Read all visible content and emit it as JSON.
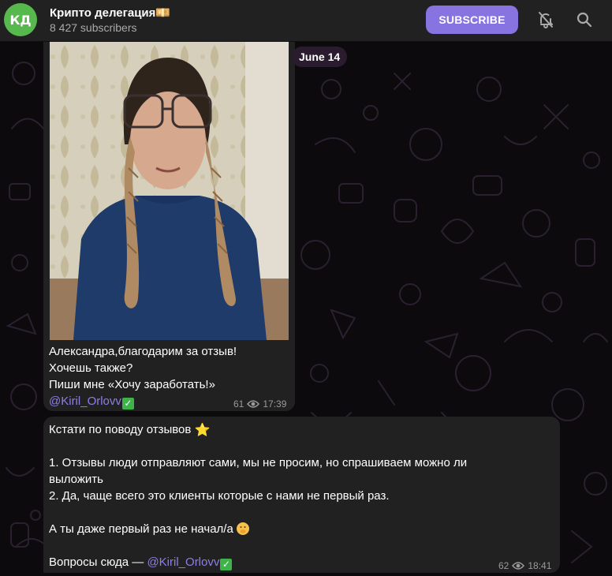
{
  "header": {
    "avatar_initials": "КД",
    "title": "Крипто делегация💴",
    "subscribers": "8 427 subscribers",
    "subscribe_label": "SUBSCRIBE",
    "icons": [
      "bell-off-icon",
      "search-icon"
    ]
  },
  "chat": {
    "date_pill": "June 14",
    "messages": [
      {
        "lines": [
          "Александра,благодарим за отзыв!",
          "Хочешь также?",
          "Пиши мне «Хочу заработать!»"
        ],
        "link": "@Kiril_Orlovv",
        "link_suffix": "✅",
        "views": "61",
        "time": "17:39"
      },
      {
        "line1": "Кстати по поводу отзывов",
        "line1_emoji": "⭐",
        "line2": "1. Отзывы люди отправляют сами, мы не просим, но спрашиваем можно ли",
        "line3": "выложить",
        "line4": "2. Да, чаще всего это клиенты которые с нами не первый раз.",
        "line5": "А ты даже первый раз не начал/а",
        "line5_emoji": "🤭",
        "line6_prefix": "Вопросы сюда — ",
        "link": "@Kiril_Orlovv",
        "link_suffix": "✅",
        "views": "62",
        "time": "18:41"
      }
    ]
  },
  "colors": {
    "accent": "#8774e1",
    "link": "#8c7ee8",
    "avatar": "#56b84d",
    "bubble": "#212121",
    "header": "#212121"
  }
}
